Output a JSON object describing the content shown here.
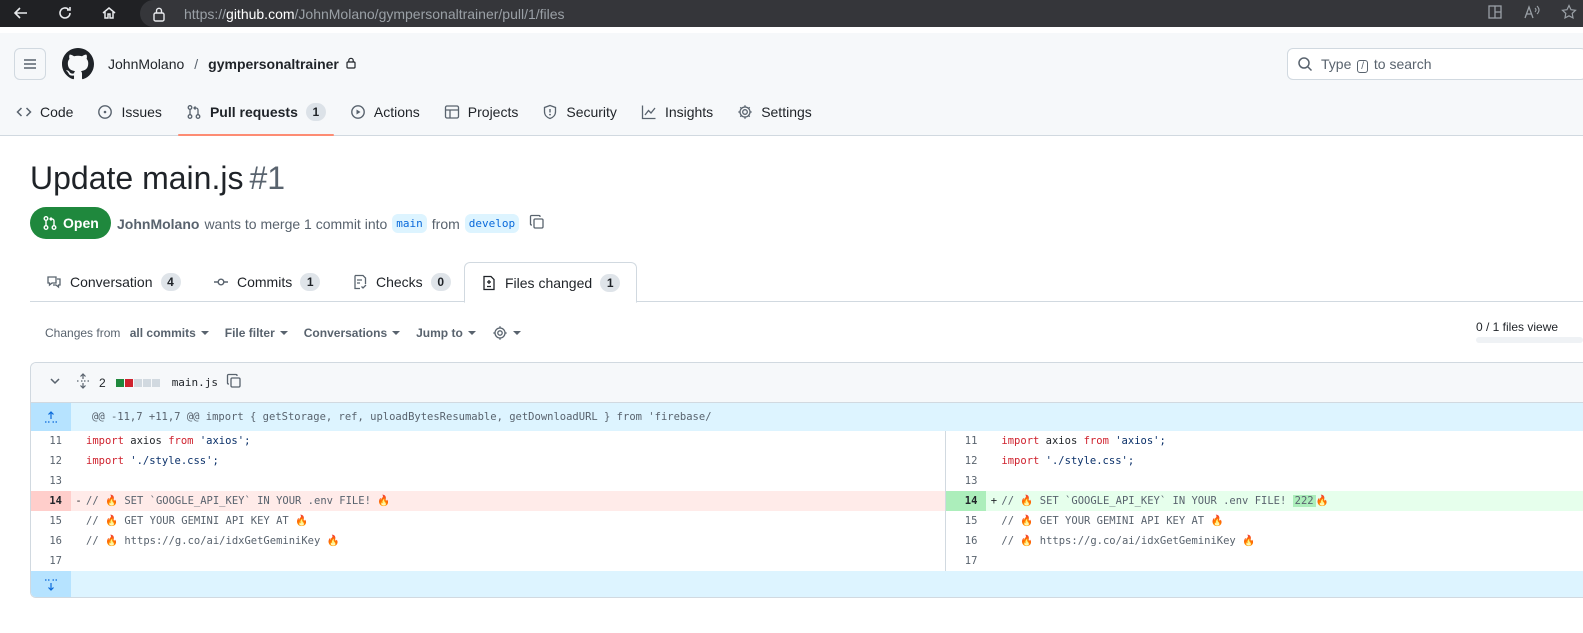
{
  "browser": {
    "url_prefix": "https://",
    "url_host": "github.com",
    "url_path": "/JohnMolano/gympersonaltrainer/pull/1/files"
  },
  "header": {
    "owner": "JohnMolano",
    "separator": "/",
    "repo": "gympersonaltrainer",
    "search_type": "Type",
    "search_key": "/",
    "search_rest": "to search"
  },
  "repo_nav": [
    {
      "label": "Code",
      "icon": "code-icon"
    },
    {
      "label": "Issues",
      "icon": "issue-icon"
    },
    {
      "label": "Pull requests",
      "icon": "pull-request-icon",
      "count": "1",
      "active": true
    },
    {
      "label": "Actions",
      "icon": "play-icon"
    },
    {
      "label": "Projects",
      "icon": "table-icon"
    },
    {
      "label": "Security",
      "icon": "shield-icon"
    },
    {
      "label": "Insights",
      "icon": "graph-icon"
    },
    {
      "label": "Settings",
      "icon": "gear-icon"
    }
  ],
  "pr": {
    "title": "Update main.js",
    "number": "#1",
    "state": "Open",
    "author": "JohnMolano",
    "merge_text_1": "wants to merge 1 commit into",
    "base_branch": "main",
    "from_text": "from",
    "head_branch": "develop"
  },
  "tabs": [
    {
      "label": "Conversation",
      "count": "4"
    },
    {
      "label": "Commits",
      "count": "1"
    },
    {
      "label": "Checks",
      "count": "0"
    },
    {
      "label": "Files changed",
      "count": "1",
      "active": true
    }
  ],
  "toolbar": {
    "changes_from": "Changes from",
    "changes_value": "all commits",
    "file_filter": "File filter",
    "conversations": "Conversations",
    "jump_to": "Jump to",
    "files_viewed": "0 / 1 files viewe"
  },
  "file": {
    "changes": "2",
    "name": "main.js",
    "hunk": "@@ -11,7 +11,7 @@ import { getStorage, ref, uploadBytesResumable, getDownloadURL } from 'firebase/",
    "left_lines": [
      {
        "n": "11",
        "type": "ctx"
      },
      {
        "n": "12",
        "type": "ctx"
      },
      {
        "n": "13",
        "type": "ctx"
      },
      {
        "n": "14",
        "type": "del",
        "sign": "-"
      },
      {
        "n": "15",
        "type": "ctx"
      },
      {
        "n": "16",
        "type": "ctx"
      },
      {
        "n": "17",
        "type": "ctx"
      }
    ],
    "right_lines": [
      {
        "n": "11",
        "type": "ctx"
      },
      {
        "n": "12",
        "type": "ctx"
      },
      {
        "n": "13",
        "type": "ctx"
      },
      {
        "n": "14",
        "type": "add",
        "sign": "+"
      },
      {
        "n": "15",
        "type": "ctx"
      },
      {
        "n": "16",
        "type": "ctx"
      },
      {
        "n": "17",
        "type": "ctx"
      }
    ],
    "code": {
      "import": "import",
      "axios": " axios ",
      "from": "from",
      "axios_str": " 'axios';",
      "style_str": " './style.css';",
      "line14": "// 🔥 SET `GOOGLE_API_KEY` IN YOUR .env FILE!",
      "line14_added": "222",
      "line15": "// 🔥 GET YOUR GEMINI API KEY AT",
      "line16": "// 🔥 https://g.co/ai/idxGetGeminiKey"
    }
  },
  "colors": {
    "open_green": "#1f883d",
    "tab_underline": "#fd8c73",
    "del_bg": "#ffebe9",
    "add_bg": "#e6ffec"
  }
}
